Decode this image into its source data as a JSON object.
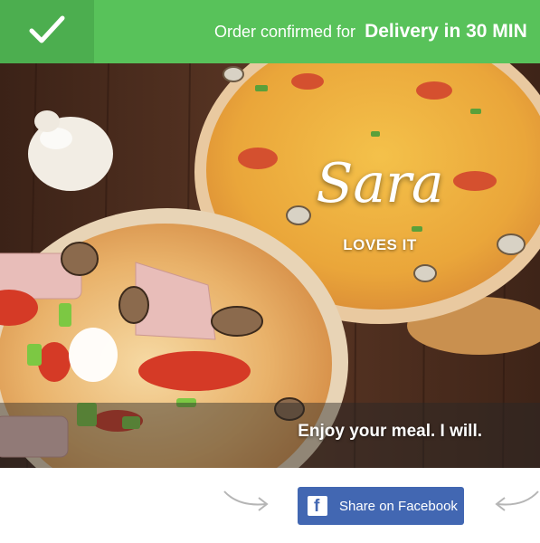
{
  "banner": {
    "prefix": "Order confirmed for",
    "highlight": "Delivery in 30 MIN",
    "icon": "checkmark-icon",
    "color": "#58c25a",
    "icon_box_color": "#4cae4f"
  },
  "hero": {
    "name": "Sara",
    "tagline": "LOVES IT",
    "caption": "Enjoy your meal. I will."
  },
  "share": {
    "label": "Share on Facebook",
    "icon": "facebook-icon",
    "color": "#4267b2"
  }
}
